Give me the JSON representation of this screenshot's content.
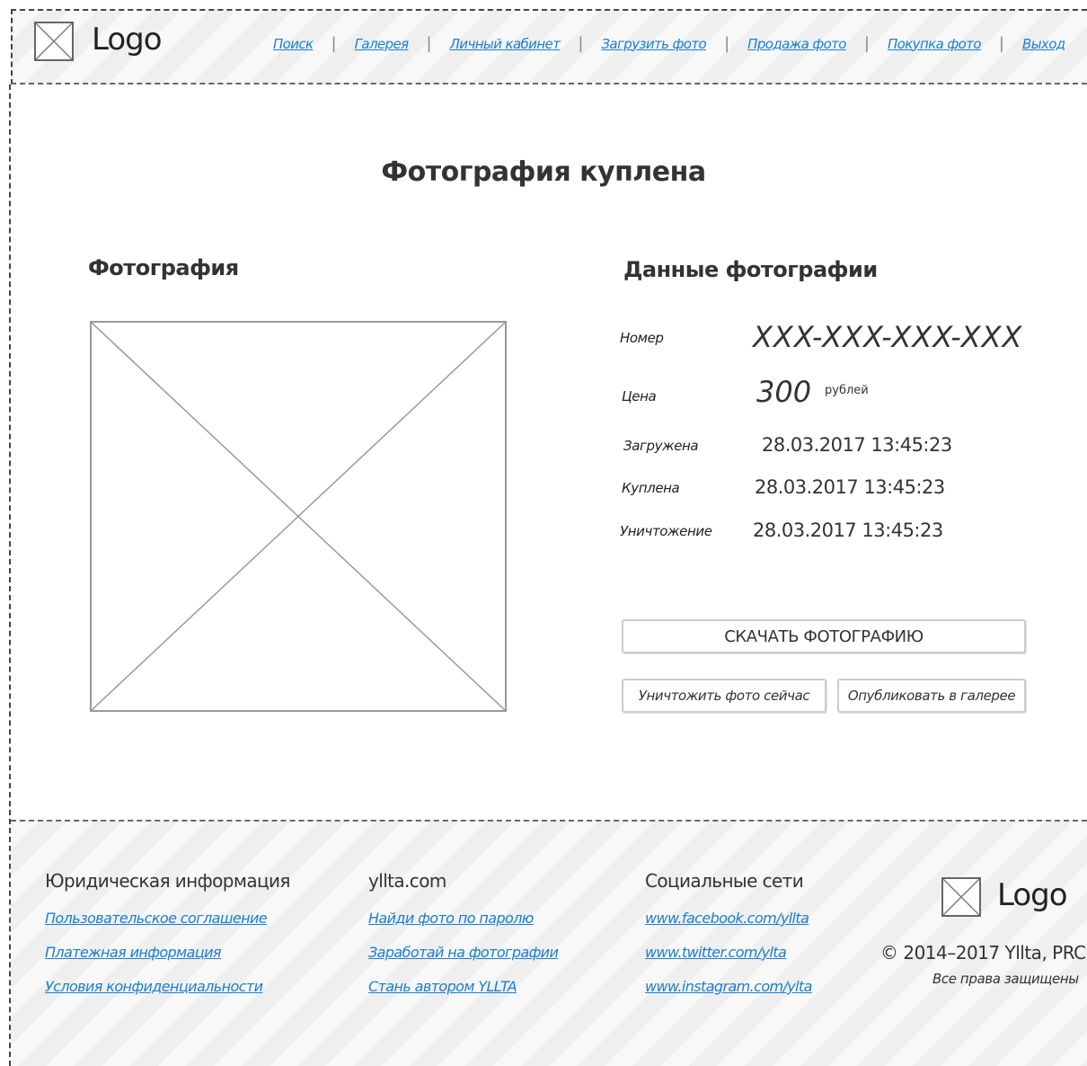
{
  "header": {
    "logo_text": "Logo",
    "nav": [
      {
        "label": "Поиск"
      },
      {
        "label": "Галерея"
      },
      {
        "label": "Личный кабинет"
      },
      {
        "label": "Загрузить фото"
      },
      {
        "label": "Продажа фото"
      },
      {
        "label": "Покупка фото"
      },
      {
        "label": "Выход"
      }
    ],
    "separator": "|"
  },
  "main": {
    "title": "Фотография куплена",
    "photo_section_title": "Фотография",
    "details_section_title": "Данные фотографии",
    "details": {
      "number_label": "Номер",
      "number_value": "XXX-XXX-XXX-XXX",
      "price_label": "Цена",
      "price_value": "300",
      "price_currency": "рублей",
      "uploaded_label": "Загружена",
      "uploaded_value": "28.03.2017 13:45:23",
      "bought_label": "Куплена",
      "bought_value": "28.03.2017 13:45:23",
      "destroy_label": "Уничтожение",
      "destroy_value": "28.03.2017 13:45:23"
    },
    "buttons": {
      "download": "СКАЧАТЬ ФОТОГРАФИЮ",
      "destroy_now": "Уничтожить фото сейчас",
      "publish": "Опубликовать в галерее"
    }
  },
  "footer": {
    "legal": {
      "title": "Юридическая информация",
      "links": [
        "Пользовательское соглашение",
        "Платежная информация",
        "Условия конфиденциальности"
      ]
    },
    "site": {
      "title": "yllta.com",
      "links": [
        "Найди фото по паролю",
        "Заработай на фотографии",
        "Стань автором YLLTA"
      ]
    },
    "social": {
      "title": "Социальные сети",
      "links": [
        "www.facebook.com/yllta",
        "www.twitter.com/ylta",
        "www.instagram.com/ylta"
      ]
    },
    "logo_text": "Logo",
    "copyright": "© 2014–2017 Yllta, PRC",
    "rights": "Все права защищены"
  }
}
